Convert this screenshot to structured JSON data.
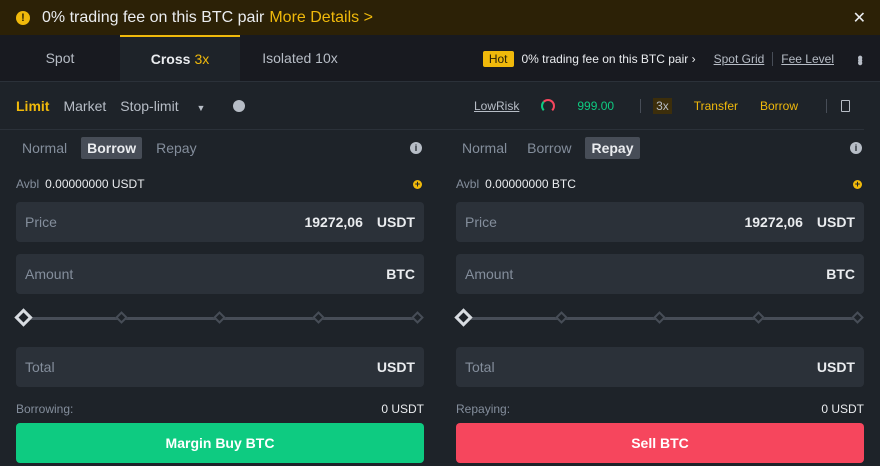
{
  "banner": {
    "text": "0% trading fee on this BTC pair",
    "link": "More Details >"
  },
  "tabs": [
    {
      "label": "Spot"
    },
    {
      "label": "Cross",
      "lev": "3x"
    },
    {
      "label": "Isolated 10x"
    }
  ],
  "promo": {
    "hot": "Hot",
    "text": "0% trading fee on this BTC pair ›",
    "spot_grid": "Spot Grid",
    "fee_level": "Fee Level"
  },
  "order_types": {
    "limit": "Limit",
    "market": "Market",
    "stop_limit": "Stop-limit"
  },
  "risk": {
    "label": "LowRisk",
    "value": "999.00",
    "lev": "3x",
    "transfer": "Transfer",
    "borrow": "Borrow"
  },
  "buy": {
    "modes": [
      "Normal",
      "Borrow",
      "Repay"
    ],
    "active": "Borrow",
    "avbl_label": "Avbl",
    "avbl": "0.00000000 USDT",
    "price_label": "Price",
    "price": "19272,06",
    "price_unit": "USDT",
    "amount_label": "Amount",
    "amount_unit": "BTC",
    "total_label": "Total",
    "total_unit": "USDT",
    "slider_percent": 0,
    "foot_label": "Borrowing:",
    "foot_value": "0 USDT",
    "button": "Margin Buy BTC"
  },
  "sell": {
    "modes": [
      "Normal",
      "Borrow",
      "Repay"
    ],
    "active": "Repay",
    "avbl_label": "Avbl",
    "avbl": "0.00000000 BTC",
    "price_label": "Price",
    "price": "19272,06",
    "price_unit": "USDT",
    "amount_label": "Amount",
    "amount_unit": "BTC",
    "total_label": "Total",
    "total_unit": "USDT",
    "slider_percent": 0,
    "foot_label": "Repaying:",
    "foot_value": "0 USDT",
    "button": "Sell BTC"
  }
}
